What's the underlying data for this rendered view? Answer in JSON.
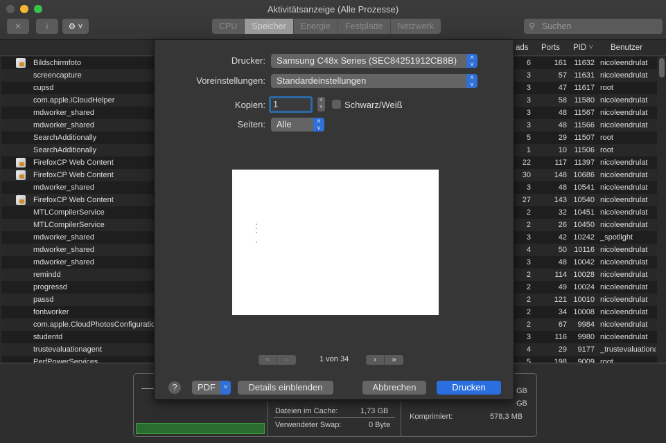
{
  "window": {
    "title": "Aktivitätsanzeige (Alle Prozesse)"
  },
  "toolbar": {
    "stop_icon": "✕",
    "info_icon": "i",
    "gear_icon": "⚙",
    "search_placeholder": "Suchen",
    "tabs": [
      "CPU",
      "Speicher",
      "Energie",
      "Festplatte",
      "Netzwerk"
    ],
    "active_tab": "Speicher"
  },
  "table": {
    "headers": {
      "threads": "ads",
      "ports": "Ports",
      "pid": "PID",
      "user": "Benutzer"
    },
    "rows": [
      {
        "name": "Bildschirmfoto",
        "icon": true,
        "threads": "6",
        "ports": "161",
        "pid": "11632",
        "user": "nicoleendrulat"
      },
      {
        "name": "screencapture",
        "threads": "3",
        "ports": "57",
        "pid": "11631",
        "user": "nicoleendrulat"
      },
      {
        "name": "cupsd",
        "threads": "3",
        "ports": "47",
        "pid": "11617",
        "user": "root"
      },
      {
        "name": "com.apple.iCloudHelper",
        "threads": "3",
        "ports": "58",
        "pid": "11580",
        "user": "nicoleendrulat"
      },
      {
        "name": "mdworker_shared",
        "threads": "3",
        "ports": "48",
        "pid": "11567",
        "user": "nicoleendrulat"
      },
      {
        "name": "mdworker_shared",
        "threads": "3",
        "ports": "48",
        "pid": "11566",
        "user": "nicoleendrulat"
      },
      {
        "name": "SearchAdditionally",
        "threads": "5",
        "ports": "29",
        "pid": "11507",
        "user": "root"
      },
      {
        "name": "SearchAdditionally",
        "threads": "1",
        "ports": "10",
        "pid": "11506",
        "user": "root"
      },
      {
        "name": "FirefoxCP Web Content",
        "icon": true,
        "threads": "22",
        "ports": "117",
        "pid": "11397",
        "user": "nicoleendrulat"
      },
      {
        "name": "FirefoxCP Web Content",
        "icon": true,
        "threads": "30",
        "ports": "148",
        "pid": "10686",
        "user": "nicoleendrulat"
      },
      {
        "name": "mdworker_shared",
        "threads": "3",
        "ports": "48",
        "pid": "10541",
        "user": "nicoleendrulat"
      },
      {
        "name": "FirefoxCP Web Content",
        "icon": true,
        "threads": "27",
        "ports": "143",
        "pid": "10540",
        "user": "nicoleendrulat"
      },
      {
        "name": "MTLCompilerService",
        "threads": "2",
        "ports": "32",
        "pid": "10451",
        "user": "nicoleendrulat"
      },
      {
        "name": "MTLCompilerService",
        "threads": "2",
        "ports": "26",
        "pid": "10450",
        "user": "nicoleendrulat"
      },
      {
        "name": "mdworker_shared",
        "threads": "3",
        "ports": "42",
        "pid": "10242",
        "user": "_spotlight"
      },
      {
        "name": "mdworker_shared",
        "threads": "4",
        "ports": "50",
        "pid": "10116",
        "user": "nicoleendrulat"
      },
      {
        "name": "mdworker_shared",
        "threads": "3",
        "ports": "48",
        "pid": "10042",
        "user": "nicoleendrulat"
      },
      {
        "name": "remindd",
        "threads": "2",
        "ports": "114",
        "pid": "10028",
        "user": "nicoleendrulat"
      },
      {
        "name": "progressd",
        "threads": "2",
        "ports": "49",
        "pid": "10024",
        "user": "nicoleendrulat"
      },
      {
        "name": "passd",
        "threads": "2",
        "ports": "121",
        "pid": "10010",
        "user": "nicoleendrulat"
      },
      {
        "name": "fontworker",
        "threads": "2",
        "ports": "34",
        "pid": "10008",
        "user": "nicoleendrulat"
      },
      {
        "name": "com.apple.CloudPhotosConfiguration",
        "threads": "2",
        "ports": "67",
        "pid": "9984",
        "user": "nicoleendrulat"
      },
      {
        "name": "studentd",
        "threads": "3",
        "ports": "116",
        "pid": "9980",
        "user": "nicoleendrulat"
      },
      {
        "name": "trustevaluationagent",
        "threads": "4",
        "ports": "29",
        "pid": "9177",
        "user": "_trustevaluationagent"
      },
      {
        "name": "PerfPowerServices",
        "threads": "5",
        "ports": "198",
        "pid": "9009",
        "user": "root"
      }
    ]
  },
  "stats": {
    "cache_label": "Dateien im Cache:",
    "cache_value": "1,73 GB",
    "swap_label": "Verwendeter Swap:",
    "swap_value": "0 Byte",
    "compressed_label": "Komprimiert:",
    "compressed_value": "578,3 MB",
    "gb1": "GB",
    "gb2": "GB"
  },
  "print": {
    "printer_label": "Drucker:",
    "printer_value": "Samsung C48x Series (SEC84251912CB8B)",
    "presets_label": "Voreinstellungen:",
    "presets_value": "Standardeinstellungen",
    "copies_label": "Kopien:",
    "copies_value": "1",
    "bw_label": "Schwarz/Weiß",
    "pages_label": "Seiten:",
    "pages_value": "Alle",
    "page_indicator": "1 von 34",
    "help": "?",
    "pdf": "PDF",
    "details": "Details einblenden",
    "cancel": "Abbrechen",
    "print": "Drucken"
  }
}
